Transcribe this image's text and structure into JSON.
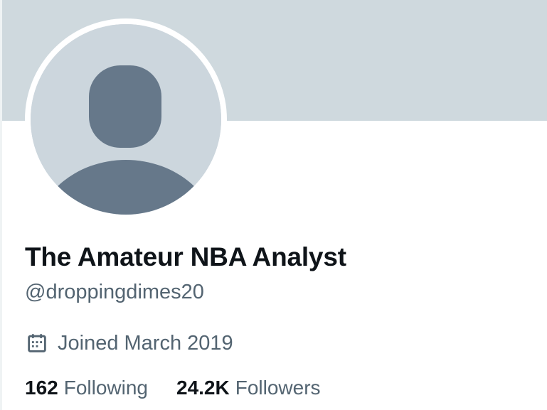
{
  "profile": {
    "display_name": "The Amateur NBA Analyst",
    "handle": "@droppingdimes20",
    "joined": "Joined March 2019",
    "following_count": "162",
    "following_label": "Following",
    "followers_count": "24.2K",
    "followers_label": "Followers"
  },
  "icons": {
    "avatar": "default-avatar-icon",
    "joined": "calendar-icon"
  },
  "colors": {
    "banner": "#cfd9de",
    "avatar_bg": "#ccd6dd",
    "avatar_figure": "#66788a",
    "primary_text": "#0f1419",
    "secondary_text": "#536471"
  }
}
